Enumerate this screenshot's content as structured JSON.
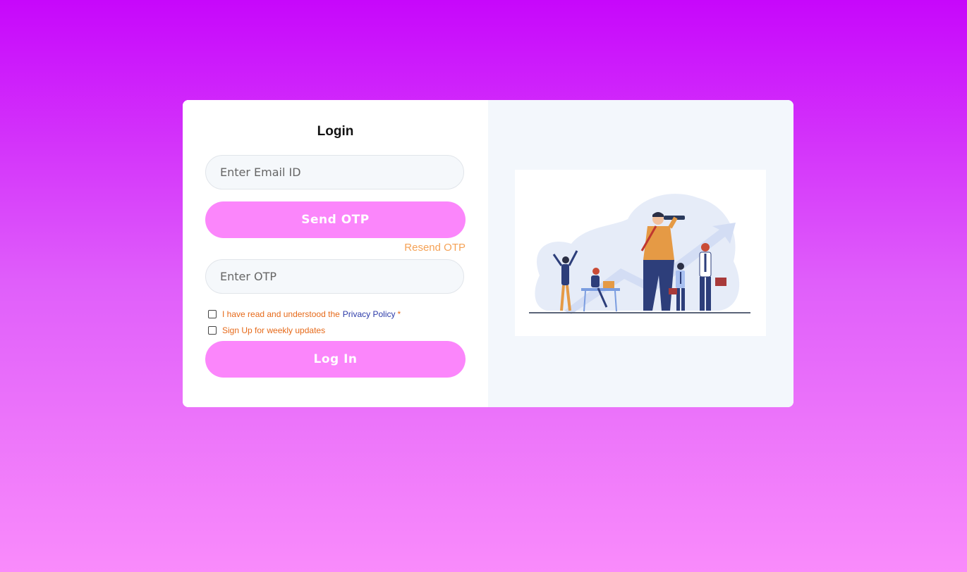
{
  "form": {
    "title": "Login",
    "email_placeholder": "Enter Email ID",
    "send_otp_label": "Send OTP",
    "resend_otp_label": "Resend OTP",
    "otp_placeholder": "Enter OTP",
    "privacy_text": "I have read and understood the",
    "privacy_link": "Privacy Policy",
    "required_mark": "*",
    "updates_text": "Sign Up for weekly updates",
    "login_label": "Log In"
  },
  "colors": {
    "background_top": "#c707fb",
    "background_bottom": "#f98bfb",
    "button": "#fb86fb",
    "resend": "#f5a256",
    "checkbox_text": "#e66a1a",
    "link": "#2b3aa8"
  },
  "illustration": {
    "icon": "team-vision-illustration"
  }
}
